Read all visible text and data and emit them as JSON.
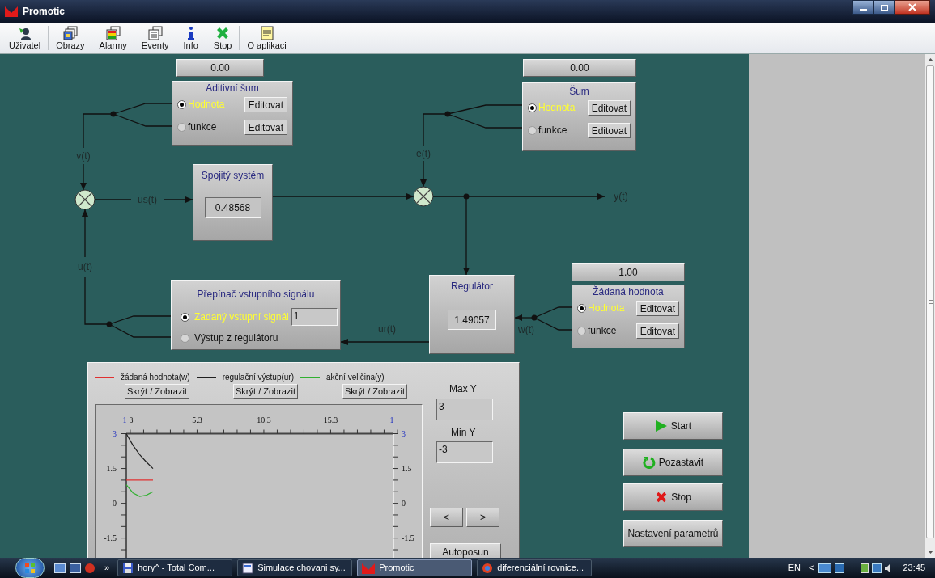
{
  "window": {
    "title": "Promotic"
  },
  "toolbar": [
    {
      "label": "Uživatel",
      "kind": "user"
    },
    {
      "label": "Obrazy",
      "kind": "images"
    },
    {
      "label": "Alarmy",
      "kind": "alarms"
    },
    {
      "label": "Eventy",
      "kind": "events"
    },
    {
      "label": "Info",
      "kind": "info"
    },
    {
      "label": "Stop",
      "kind": "stop"
    },
    {
      "label": "O aplikaci",
      "kind": "about"
    }
  ],
  "diagram": {
    "additive_noise": {
      "display": "0.00",
      "title": "Aditivní šum",
      "options": [
        {
          "label": "Hodnota",
          "selected": true,
          "button": "Editovat"
        },
        {
          "label": "funkce",
          "selected": false,
          "button": "Editovat"
        }
      ]
    },
    "noise": {
      "display": "0.00",
      "title": "Šum",
      "options": [
        {
          "label": "Hodnota",
          "selected": true,
          "button": "Editovat"
        },
        {
          "label": "funkce",
          "selected": false,
          "button": "Editovat"
        }
      ]
    },
    "continuous_system": {
      "title": "Spojitý systém",
      "value": "0.48568"
    },
    "controller": {
      "title": "Regulátor",
      "value": "1.49057"
    },
    "setpoint": {
      "display": "1.00",
      "title": "Žádaná hodnota",
      "options": [
        {
          "label": "Hodnota",
          "selected": true,
          "button": "Editovat"
        },
        {
          "label": "funkce",
          "selected": false,
          "button": "Editovat"
        }
      ]
    },
    "input_switch": {
      "title": "Přepínač vstupního signálu",
      "options": [
        {
          "label": "Zadaný vstupní signál",
          "selected": true,
          "value": "1"
        },
        {
          "label": "Výstup z regulátoru",
          "selected": false
        }
      ]
    },
    "signal_labels": [
      "v(t)",
      "us(t)",
      "e(t)",
      "y(t)",
      "u(t)",
      "ur(t)",
      "w(t)"
    ]
  },
  "chart_panel": {
    "toggle_buttons": [
      "Skrýt / Zobrazit",
      "Skrýt / Zobrazit",
      "Skrýt / Zobrazit"
    ],
    "first_tick_label": "3",
    "cursor_markers": [
      "1",
      "1"
    ],
    "left_axis_labels": [
      "3",
      "1.5",
      "0",
      "-1.5"
    ],
    "right_axis_labels": [
      "3",
      "1.5",
      "0",
      "-1.5"
    ],
    "chart_data": {
      "type": "line",
      "x": [
        0,
        0.5,
        1,
        1.5,
        2
      ],
      "xlim": [
        0,
        20
      ],
      "ylim": [
        -2.4,
        3
      ],
      "xticks": [
        5.3,
        10.3,
        15.3
      ],
      "yticks": [
        3,
        1.5,
        0,
        -1.5
      ],
      "series": [
        {
          "name": "žádaná hodnota(w)",
          "color": "#e03030",
          "values": [
            1,
            1,
            1,
            1,
            1
          ]
        },
        {
          "name": "regulační výstup(ur)",
          "color": "#202020",
          "values": [
            3,
            2.5,
            2.1,
            1.78,
            1.5
          ]
        },
        {
          "name": "akční veličina(y)",
          "color": "#30b030",
          "values": [
            0.8,
            0.45,
            0.3,
            0.35,
            0.5
          ]
        }
      ]
    },
    "max_y": {
      "label": "Max Y",
      "value": "3"
    },
    "min_y": {
      "label": "Min Y",
      "value": "-3"
    },
    "nav_buttons": [
      "<",
      ">"
    ],
    "autoscroll_button": "Autoposun"
  },
  "controls": [
    {
      "label": "Start",
      "kind": "play"
    },
    {
      "label": "Pozastavit",
      "kind": "restart"
    },
    {
      "label": "Stop",
      "kind": "stop"
    },
    {
      "label": "Nastavení parametrů",
      "kind": "none"
    }
  ],
  "taskbar": {
    "more": "»",
    "tasks": [
      {
        "label": "hory^ - Total Com...",
        "kind": "disk",
        "selected": false
      },
      {
        "label": "Simulace chovani sy...",
        "kind": "doc",
        "selected": false
      },
      {
        "label": "Promotic",
        "kind": "logo",
        "selected": true
      },
      {
        "label": "diferenciální rovnice...",
        "kind": "browser",
        "selected": false
      }
    ],
    "language": "EN",
    "tray_expand": "<",
    "clock": "23:45"
  }
}
